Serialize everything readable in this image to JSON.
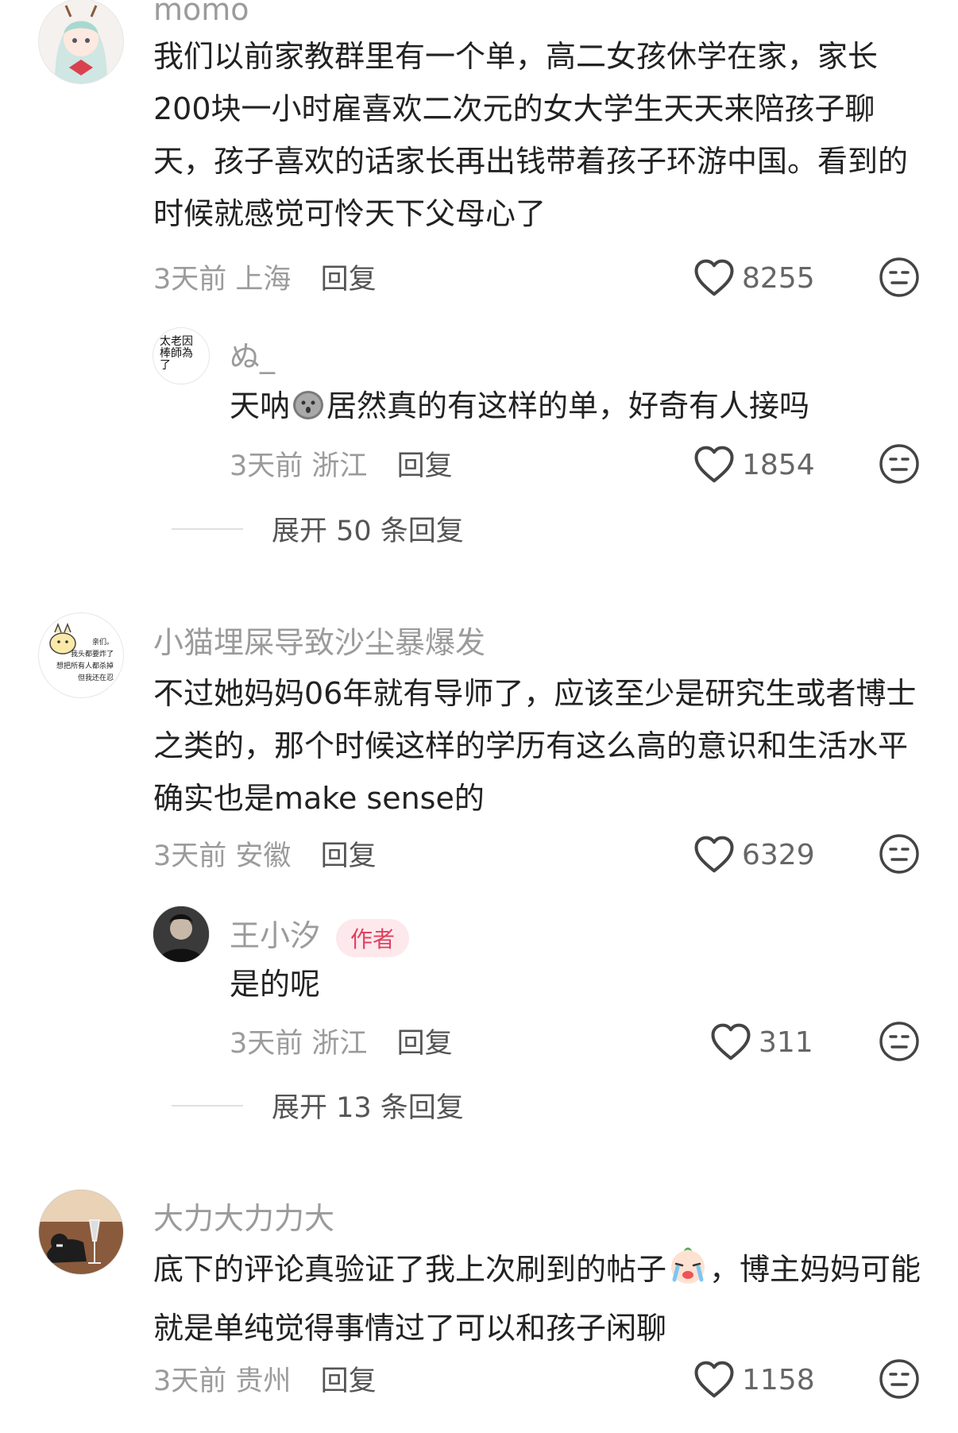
{
  "comments": [
    {
      "user": "momo",
      "text": "我们以前家教群里有一个单，高二女孩休学在家，家长200块一小时雇喜欢二次元的女大学生天天来陪孩子聊天，孩子喜欢的话家长再出钱带着孩子环游中国。看到的时候就感觉可怜天下父母心了",
      "time": "3天前",
      "location": "上海",
      "reply_label": "回复",
      "likes": "8255",
      "replies": [
        {
          "user": "ぬ_",
          "avatar_text": "太老因\n棒師為\n了",
          "text_before": "天呐",
          "text_after": "居然真的有这样的单，好奇有人接吗",
          "time": "3天前",
          "location": "浙江",
          "reply_label": "回复",
          "likes": "1854"
        }
      ],
      "expand_label": "展开 50 条回复"
    },
    {
      "user": "小猫埋屎导致沙尘暴爆发",
      "avatar_text": "亲们。\n我头都要炸了\n想把所有人都杀掉\n但我还在忍",
      "text": "不过她妈妈06年就有导师了，应该至少是研究生或者博士之类的，那个时候这样的学历有这么高的意识和生活水平确实也是make sense的",
      "time": "3天前",
      "location": "安徽",
      "reply_label": "回复",
      "likes": "6329",
      "replies": [
        {
          "user": "王小汐",
          "badge": "作者",
          "text": "是的呢",
          "time": "3天前",
          "location": "浙江",
          "reply_label": "回复",
          "likes": "311"
        }
      ],
      "expand_label": "展开 13 条回复"
    },
    {
      "user": "大力大力力大",
      "text_before": "底下的评论真验证了我上次刷到的帖子",
      "text_after": "，博主妈妈可能就是单纯觉得事情过了可以和孩子闲聊",
      "time": "3天前",
      "location": "贵州",
      "reply_label": "回复",
      "likes": "1158"
    }
  ],
  "icons": [
    "heart-icon",
    "dislike-face-icon"
  ],
  "colors": {
    "meta": "#9b9b9b",
    "badge_bg": "#fde8ec",
    "badge_text": "#e0415e"
  }
}
